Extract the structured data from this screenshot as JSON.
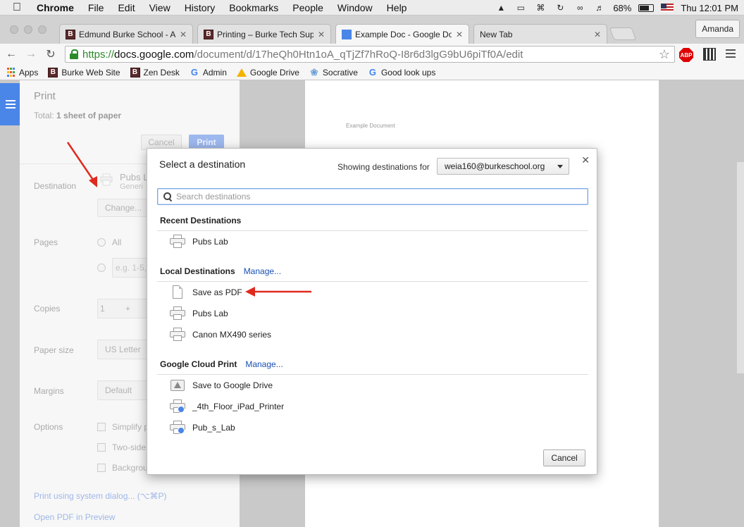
{
  "menubar": {
    "app_name": "Chrome",
    "items": [
      "File",
      "Edit",
      "View",
      "History",
      "Bookmarks",
      "People",
      "Window",
      "Help"
    ],
    "battery": "68%",
    "clock": "Thu 12:01 PM"
  },
  "tabs": [
    {
      "title": "Edmund Burke School - Ag",
      "favicon": "B"
    },
    {
      "title": "Printing – Burke Tech Supp",
      "favicon": "B"
    },
    {
      "title": "Example Doc - Google Doc",
      "favicon": "doc"
    },
    {
      "title": "New Tab",
      "favicon": ""
    }
  ],
  "profile": "Amanda",
  "address": {
    "scheme": "https://",
    "host": "docs.google.com",
    "path": "/document/d/17heQh0Htn1oA_qTjZf7hRoQ-I8r6d3lgG9bU6piTf0A/edit"
  },
  "extensions": {
    "abp_label": "ABP"
  },
  "bookmarks": [
    {
      "label": "Apps",
      "icon": "apps-icon"
    },
    {
      "label": "Burke Web Site",
      "icon": "burke-icon"
    },
    {
      "label": "Zen Desk",
      "icon": "burke-icon"
    },
    {
      "label": "Admin",
      "icon": "google-icon"
    },
    {
      "label": "Google Drive",
      "icon": "drive-icon"
    },
    {
      "label": "Socrative",
      "icon": "socrative-icon"
    },
    {
      "label": "Good look ups",
      "icon": "google-icon"
    }
  ],
  "print_panel": {
    "title": "Print",
    "total_prefix": "Total: ",
    "total_value": "1 sheet of paper",
    "cancel": "Cancel",
    "print": "Print",
    "destination_label": "Destination",
    "destination_name": "Pubs L",
    "destination_sub": "Generi",
    "change_button": "Change...",
    "pages_label": "Pages",
    "pages_all": "All",
    "pages_custom_placeholder": "e.g. 1-5,",
    "copies_label": "Copies",
    "copies_value": "1",
    "copies_plus": "+",
    "paper_size_label": "Paper size",
    "paper_size_value": "US Letter",
    "margins_label": "Margins",
    "margins_value": "Default",
    "options_label": "Options",
    "option_simplify": "Simplify p",
    "option_two_sided": "Two-side",
    "option_background": "Backgrou",
    "system_dialog_link": "Print using system dialog... (⌥⌘P)",
    "open_pdf_link": "Open PDF in Preview"
  },
  "preview": {
    "doc_title": "Example Document"
  },
  "dialog": {
    "title": "Select a destination",
    "showing_for": "Showing destinations for",
    "account": "weia160@burkeschool.org",
    "search_placeholder": "Search destinations",
    "recent_heading": "Recent Destinations",
    "recent": [
      "Pubs Lab"
    ],
    "local_heading": "Local Destinations",
    "local_manage": "Manage...",
    "local": [
      "Save as PDF",
      "Pubs Lab",
      "Canon MX490 series"
    ],
    "cloud_heading": "Google Cloud Print",
    "cloud_manage": "Manage...",
    "cloud": [
      "Save to Google Drive",
      "_4th_Floor_iPad_Printer",
      "Pub_s_Lab"
    ],
    "cancel": "Cancel"
  },
  "colors": {
    "annotation_arrow": "#e02a1f",
    "link": "#1a4fb5",
    "docs_blue": "#4a86e8"
  }
}
